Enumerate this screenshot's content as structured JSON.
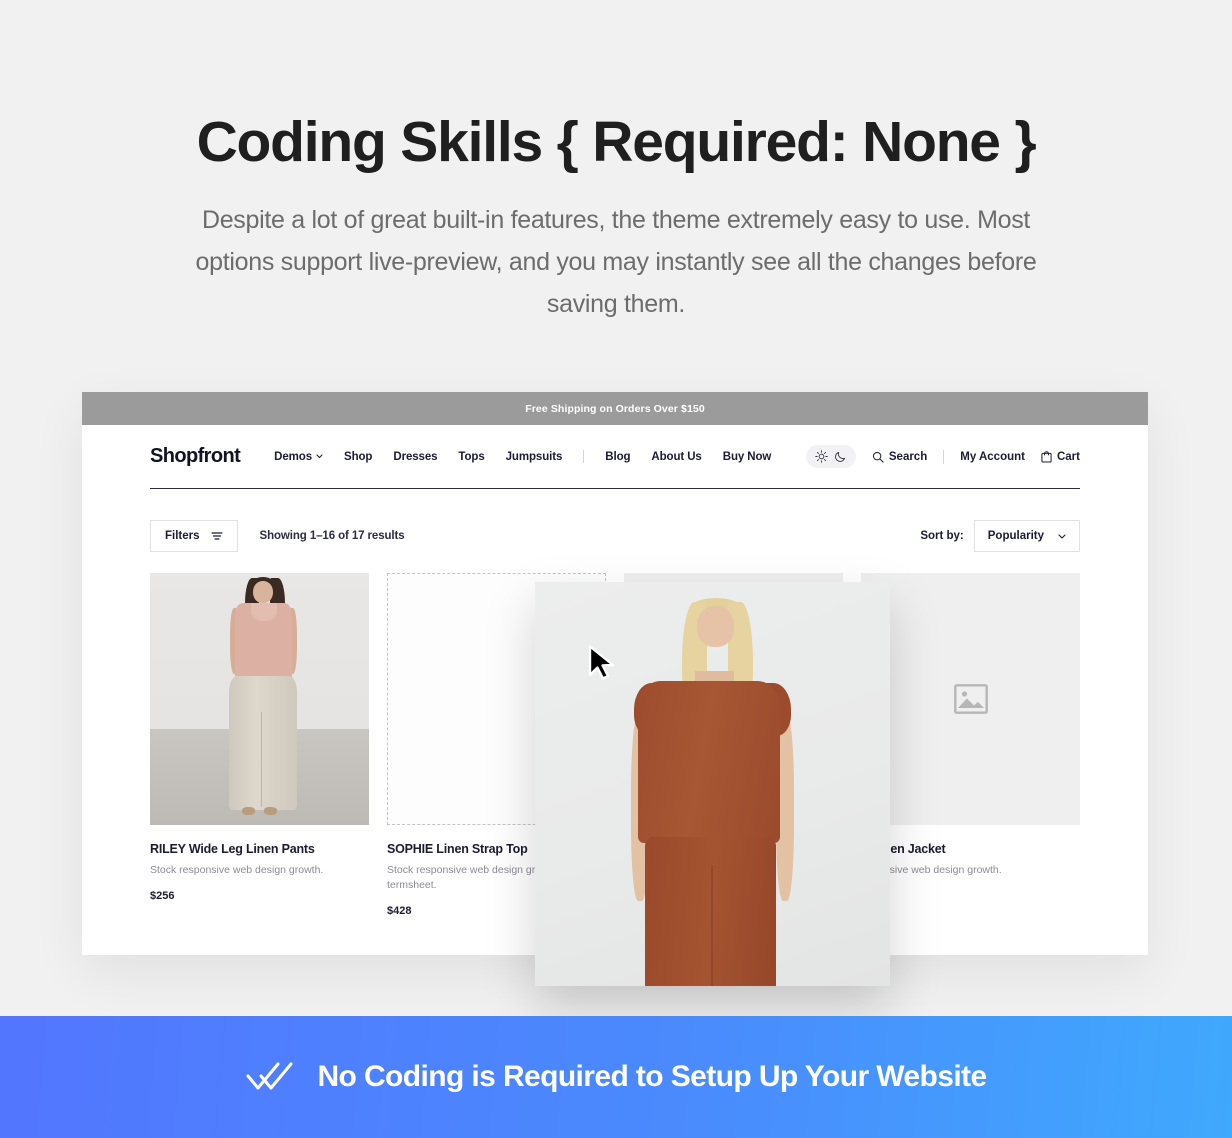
{
  "hero": {
    "title": "Coding Skills { Required: None }",
    "subtitle": "Despite a lot of great built-in features, the theme extremely easy to use. Most options support live-preview, and you may instantly see all the changes before saving them."
  },
  "shop": {
    "announcement": "Free Shipping on Orders Over $150",
    "brand": "Shopfront",
    "nav": [
      {
        "label": "Demos",
        "has_caret": true
      },
      {
        "label": "Shop",
        "has_caret": false
      },
      {
        "label": "Dresses",
        "has_caret": false
      },
      {
        "label": "Tops",
        "has_caret": false
      },
      {
        "label": "Jumpsuits",
        "has_caret": false
      },
      {
        "label": "Blog",
        "has_caret": false
      },
      {
        "label": "About Us",
        "has_caret": false
      },
      {
        "label": "Buy Now",
        "has_caret": false
      }
    ],
    "actions": {
      "theme_light_icon": "sun-icon",
      "theme_dark_icon": "moon-icon",
      "search_label": "Search",
      "search_icon": "search-icon",
      "account_label": "My Account",
      "cart_label": "Cart",
      "cart_icon": "shopping-bag-icon"
    },
    "toolbar": {
      "filters_label": "Filters",
      "filters_icon": "filter-icon",
      "results_text": "Showing 1–16 of 17 results",
      "sort_label": "Sort by:",
      "sort_value": "Popularity",
      "sort_caret_icon": "chevron-down-icon"
    },
    "products": [
      {
        "title": "RILEY Wide Leg Linen Pants",
        "description": "Stock responsive web design growth.",
        "price": "$256",
        "thumb_state": "photo"
      },
      {
        "title": "SOPHIE Linen Strap Top",
        "description": "Stock responsive web design growth hacking termsheet.",
        "price": "$428",
        "thumb_state": "dropzone"
      },
      {
        "title": "",
        "description": "",
        "price": "",
        "thumb_state": "placeholder"
      },
      {
        "title": "Y Linen Jacket",
        "description": "esponsive web design growth.",
        "price": "",
        "thumb_state": "placeholder"
      }
    ],
    "dragged_item": {
      "alt": "Model wearing rust linen top and wide leg pants",
      "cursor_icon": "arrow-cursor-icon"
    }
  },
  "banner": {
    "text": "No Coding is Required to Setup Up Your Website",
    "icon": "double-check-icon",
    "gradient_start": "#5276fe",
    "gradient_end": "#3fa9fd"
  },
  "colors": {
    "page_background": "#f1f1f1",
    "announcement_bar": "#9b9b9b",
    "text_dark": "#1b1c30",
    "text_muted": "#6c6c6c"
  }
}
